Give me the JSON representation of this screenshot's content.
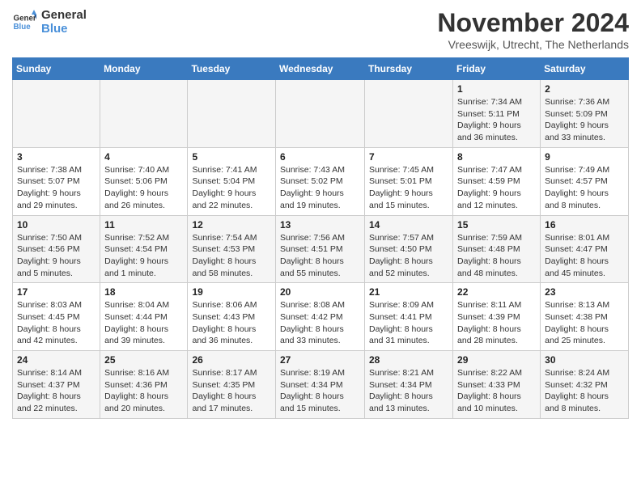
{
  "logo": {
    "line1": "General",
    "line2": "Blue"
  },
  "title": "November 2024",
  "location": "Vreeswijk, Utrecht, The Netherlands",
  "weekdays": [
    "Sunday",
    "Monday",
    "Tuesday",
    "Wednesday",
    "Thursday",
    "Friday",
    "Saturday"
  ],
  "weeks": [
    [
      {
        "day": "",
        "info": ""
      },
      {
        "day": "",
        "info": ""
      },
      {
        "day": "",
        "info": ""
      },
      {
        "day": "",
        "info": ""
      },
      {
        "day": "",
        "info": ""
      },
      {
        "day": "1",
        "info": "Sunrise: 7:34 AM\nSunset: 5:11 PM\nDaylight: 9 hours\nand 36 minutes."
      },
      {
        "day": "2",
        "info": "Sunrise: 7:36 AM\nSunset: 5:09 PM\nDaylight: 9 hours\nand 33 minutes."
      }
    ],
    [
      {
        "day": "3",
        "info": "Sunrise: 7:38 AM\nSunset: 5:07 PM\nDaylight: 9 hours\nand 29 minutes."
      },
      {
        "day": "4",
        "info": "Sunrise: 7:40 AM\nSunset: 5:06 PM\nDaylight: 9 hours\nand 26 minutes."
      },
      {
        "day": "5",
        "info": "Sunrise: 7:41 AM\nSunset: 5:04 PM\nDaylight: 9 hours\nand 22 minutes."
      },
      {
        "day": "6",
        "info": "Sunrise: 7:43 AM\nSunset: 5:02 PM\nDaylight: 9 hours\nand 19 minutes."
      },
      {
        "day": "7",
        "info": "Sunrise: 7:45 AM\nSunset: 5:01 PM\nDaylight: 9 hours\nand 15 minutes."
      },
      {
        "day": "8",
        "info": "Sunrise: 7:47 AM\nSunset: 4:59 PM\nDaylight: 9 hours\nand 12 minutes."
      },
      {
        "day": "9",
        "info": "Sunrise: 7:49 AM\nSunset: 4:57 PM\nDaylight: 9 hours\nand 8 minutes."
      }
    ],
    [
      {
        "day": "10",
        "info": "Sunrise: 7:50 AM\nSunset: 4:56 PM\nDaylight: 9 hours\nand 5 minutes."
      },
      {
        "day": "11",
        "info": "Sunrise: 7:52 AM\nSunset: 4:54 PM\nDaylight: 9 hours\nand 1 minute."
      },
      {
        "day": "12",
        "info": "Sunrise: 7:54 AM\nSunset: 4:53 PM\nDaylight: 8 hours\nand 58 minutes."
      },
      {
        "day": "13",
        "info": "Sunrise: 7:56 AM\nSunset: 4:51 PM\nDaylight: 8 hours\nand 55 minutes."
      },
      {
        "day": "14",
        "info": "Sunrise: 7:57 AM\nSunset: 4:50 PM\nDaylight: 8 hours\nand 52 minutes."
      },
      {
        "day": "15",
        "info": "Sunrise: 7:59 AM\nSunset: 4:48 PM\nDaylight: 8 hours\nand 48 minutes."
      },
      {
        "day": "16",
        "info": "Sunrise: 8:01 AM\nSunset: 4:47 PM\nDaylight: 8 hours\nand 45 minutes."
      }
    ],
    [
      {
        "day": "17",
        "info": "Sunrise: 8:03 AM\nSunset: 4:45 PM\nDaylight: 8 hours\nand 42 minutes."
      },
      {
        "day": "18",
        "info": "Sunrise: 8:04 AM\nSunset: 4:44 PM\nDaylight: 8 hours\nand 39 minutes."
      },
      {
        "day": "19",
        "info": "Sunrise: 8:06 AM\nSunset: 4:43 PM\nDaylight: 8 hours\nand 36 minutes."
      },
      {
        "day": "20",
        "info": "Sunrise: 8:08 AM\nSunset: 4:42 PM\nDaylight: 8 hours\nand 33 minutes."
      },
      {
        "day": "21",
        "info": "Sunrise: 8:09 AM\nSunset: 4:41 PM\nDaylight: 8 hours\nand 31 minutes."
      },
      {
        "day": "22",
        "info": "Sunrise: 8:11 AM\nSunset: 4:39 PM\nDaylight: 8 hours\nand 28 minutes."
      },
      {
        "day": "23",
        "info": "Sunrise: 8:13 AM\nSunset: 4:38 PM\nDaylight: 8 hours\nand 25 minutes."
      }
    ],
    [
      {
        "day": "24",
        "info": "Sunrise: 8:14 AM\nSunset: 4:37 PM\nDaylight: 8 hours\nand 22 minutes."
      },
      {
        "day": "25",
        "info": "Sunrise: 8:16 AM\nSunset: 4:36 PM\nDaylight: 8 hours\nand 20 minutes."
      },
      {
        "day": "26",
        "info": "Sunrise: 8:17 AM\nSunset: 4:35 PM\nDaylight: 8 hours\nand 17 minutes."
      },
      {
        "day": "27",
        "info": "Sunrise: 8:19 AM\nSunset: 4:34 PM\nDaylight: 8 hours\nand 15 minutes."
      },
      {
        "day": "28",
        "info": "Sunrise: 8:21 AM\nSunset: 4:34 PM\nDaylight: 8 hours\nand 13 minutes."
      },
      {
        "day": "29",
        "info": "Sunrise: 8:22 AM\nSunset: 4:33 PM\nDaylight: 8 hours\nand 10 minutes."
      },
      {
        "day": "30",
        "info": "Sunrise: 8:24 AM\nSunset: 4:32 PM\nDaylight: 8 hours\nand 8 minutes."
      }
    ]
  ]
}
